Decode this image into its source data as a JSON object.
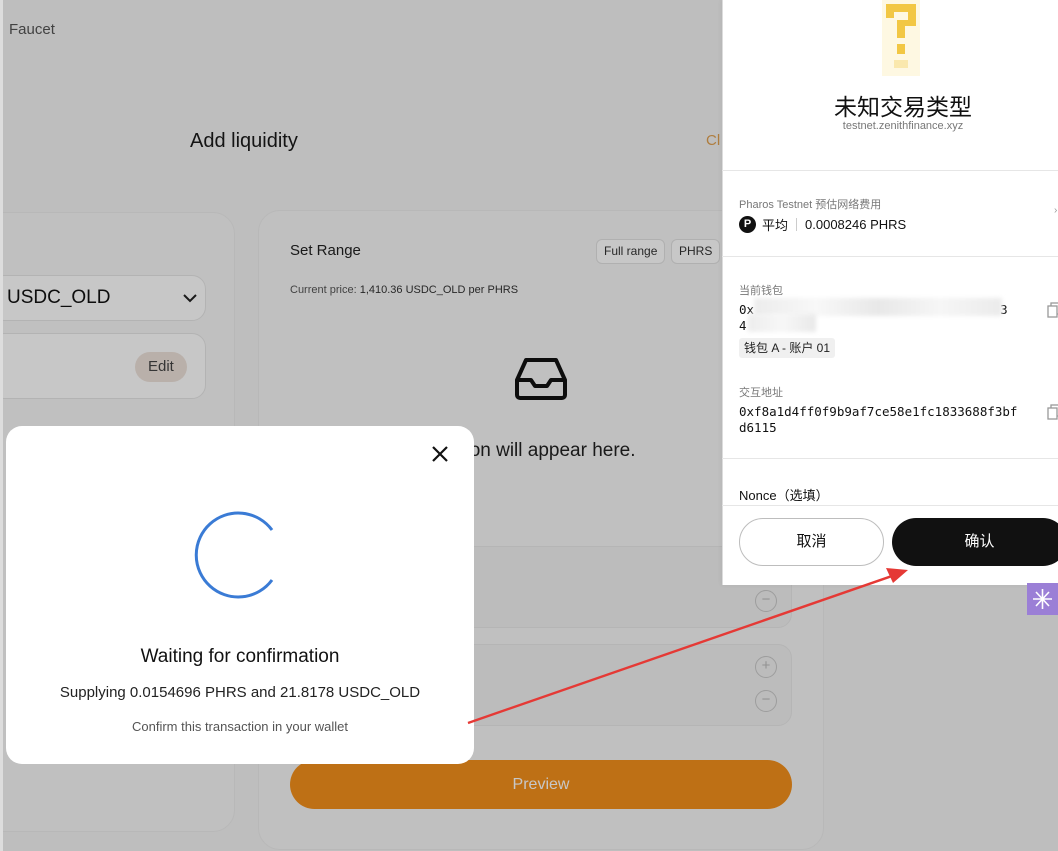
{
  "nav": {
    "faucet_label": "Faucet"
  },
  "page": {
    "title": "Add liquidity",
    "clear_fragment": "Cl"
  },
  "left_panel": {
    "token": "USDC_OLD",
    "edit_label": "Edit"
  },
  "range": {
    "title": "Set Range",
    "full_range_label": "Full range",
    "token_label": "PHRS",
    "current_price_label": "Current price:",
    "current_price_value": "1,410.36 USDC_OLD per PHRS",
    "empty_message": "sition will appear here.",
    "plus": "+",
    "minus": "−"
  },
  "preview_label": "Preview",
  "modal": {
    "title": "Waiting for confirmation",
    "supplying": "Supplying 0.0154696 PHRS and 21.8178 USDC_OLD",
    "hint": "Confirm this transaction in your wallet"
  },
  "wallet": {
    "title": "未知交易类型",
    "site": "testnet.zenithfinance.xyz",
    "network_fee_label": "Pharos Testnet 预估网络费用",
    "fee_logo": "P",
    "fee_speed": "平均",
    "fee_value": "0.0008246 PHRS",
    "current_wallet_label": "当前钱包",
    "wallet_addr_line1": "0x",
    "wallet_addr_end1": "3",
    "wallet_addr_line2": "4",
    "account_tag": "钱包 A - 账户 01",
    "interact_label": "交互地址",
    "interact_addr": "0xf8a1d4ff0f9b9af7ce58e1fc1833688f3bfd6115",
    "nonce_label": "Nonce（选填）",
    "cancel_label": "取消",
    "confirm_label": "确认"
  },
  "colors": {
    "accent_orange": "#f4901c",
    "spinner_blue": "#3a7bd5",
    "arrow_red": "#e53935",
    "wallet_icon_yellow": "#f2c744"
  }
}
